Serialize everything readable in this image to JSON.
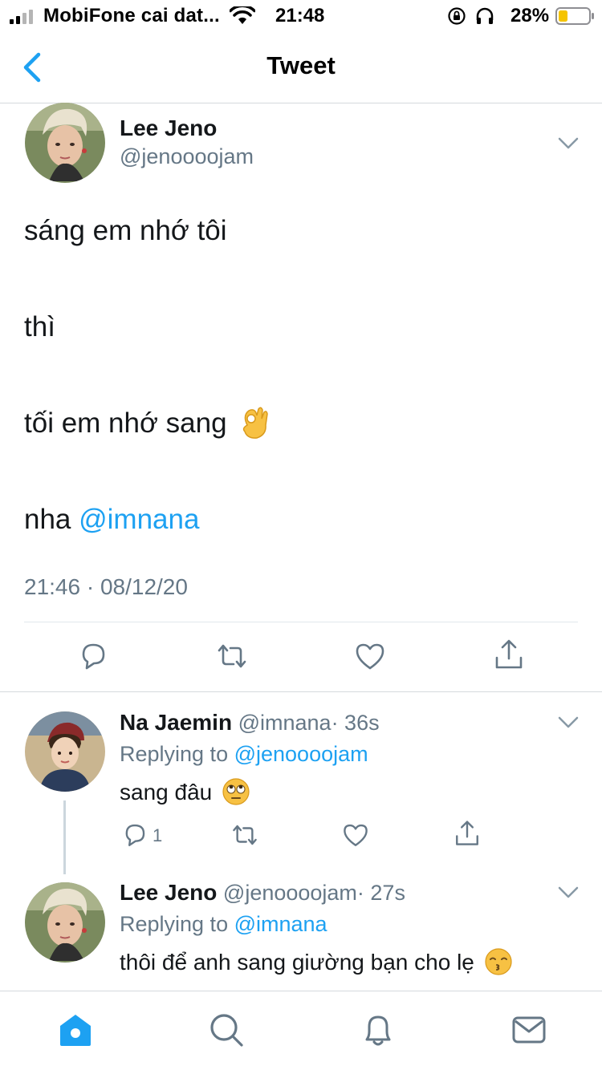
{
  "status_bar": {
    "carrier": "MobiFone cai dat...",
    "time": "21:48",
    "battery": "28%",
    "icons": [
      "signal-icon",
      "wifi-icon",
      "rotation-lock-icon",
      "headphones-icon",
      "battery-icon"
    ]
  },
  "nav": {
    "title": "Tweet",
    "back_icon": "chevron-left-icon"
  },
  "main_tweet": {
    "name": "Lee Jeno",
    "handle": "@jenoooojam",
    "lines": [
      "sáng em nhớ tôi",
      "thì",
      "tối em nhớ sang"
    ],
    "last_line_prefix": "nha ",
    "mention": "@imnana",
    "emoji": "ok-hand-emoji",
    "timestamp": "21:46 · 08/12/20",
    "actions": [
      "reply-icon",
      "retweet-icon",
      "like-icon",
      "share-icon"
    ]
  },
  "replies": [
    {
      "name": "Na Jaemin",
      "handle": "@imnana",
      "time": "· 36s",
      "replying_prefix": "Replying to ",
      "replying_to": "@jenoooojam",
      "text": "sang đâu",
      "emoji": "eye-roll-emoji",
      "reply_count": "1"
    },
    {
      "name": "Lee Jeno",
      "handle": "@jenoooojam",
      "time": "· 27s",
      "replying_prefix": "Replying to ",
      "replying_to": "@imnana",
      "text": "thôi để anh sang giường bạn cho lẹ",
      "emoji": "kissing-emoji"
    }
  ],
  "tab_bar": {
    "tabs": [
      "home-icon",
      "search-icon",
      "notifications-icon",
      "messages-icon"
    ],
    "active_color": "#1da1f2"
  },
  "colors": {
    "accent": "#1da1f2",
    "text": "#14171a",
    "secondary": "#657786",
    "divider": "#e1e8ed"
  }
}
